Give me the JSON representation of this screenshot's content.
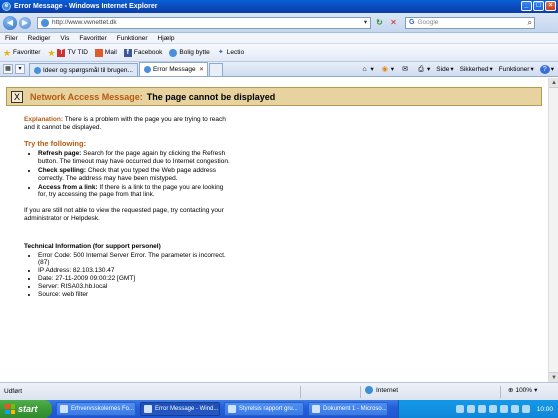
{
  "window": {
    "title": "Error Message - Windows Internet Explorer",
    "buttons": [
      "_",
      "□",
      "×"
    ]
  },
  "address_bar": {
    "url": "http://www.vwnettet.dk",
    "search_placeholder": "Google"
  },
  "menu": [
    "Filer",
    "Rediger",
    "Vis",
    "Favoritter",
    "Funktioner",
    "Hjælp"
  ],
  "favorites": {
    "label": "Favoritter",
    "items": [
      "TV TID",
      "Mail",
      "Facebook",
      "Bolig bytte",
      "Lectio"
    ]
  },
  "tabs": [
    {
      "label": "Ideer og spørgsmål til brugen..."
    },
    {
      "label": "Error Message"
    }
  ],
  "command_bar": {
    "side": "Side",
    "safety": "Sikkerhed",
    "tools": "Funktioner",
    "help": "?"
  },
  "error": {
    "banner_lead": "Network Access Message:",
    "banner_msg": "The page cannot be displayed",
    "explanation_label": "Explanation:",
    "explanation": " There is a problem with the page you are trying to reach and it cannot be displayed.",
    "try_heading": "Try the following:",
    "tips": [
      {
        "title": "Refresh page:",
        "text": " Search for the page again by clicking the Refresh button. The timeout may have occurred due to Internet congestion."
      },
      {
        "title": "Check spelling:",
        "text": " Check that you typed the Web page address correctly. The address may have been mistyped."
      },
      {
        "title": "Access from a link:",
        "text": " If there is a link to the page you are looking for, try accessing the page from that link."
      }
    ],
    "contact": "If you are still not able to view the requested page, try contacting your administrator or Helpdesk.",
    "tech_title": "Technical Information (for support personel)",
    "tech_items": [
      "Error Code: 500 Internal Server Error. The parameter is incorrect. (87)",
      "IP Address: 82.103.130.47",
      "Date: 27-11-2009 09:00:22 [GMT]",
      "Server: RISA03.hb.local",
      "Source: web filter"
    ]
  },
  "status": {
    "text": "Udført",
    "zone": "Internet",
    "zoom": "100%"
  },
  "taskbar": {
    "start": "start",
    "buttons": [
      "Erhvervsskolernes Fo...",
      "Error Message - Wind...",
      "Styrelsis rapport gru...",
      "Dokument 1 - Microso..."
    ],
    "clock": "10:00"
  }
}
